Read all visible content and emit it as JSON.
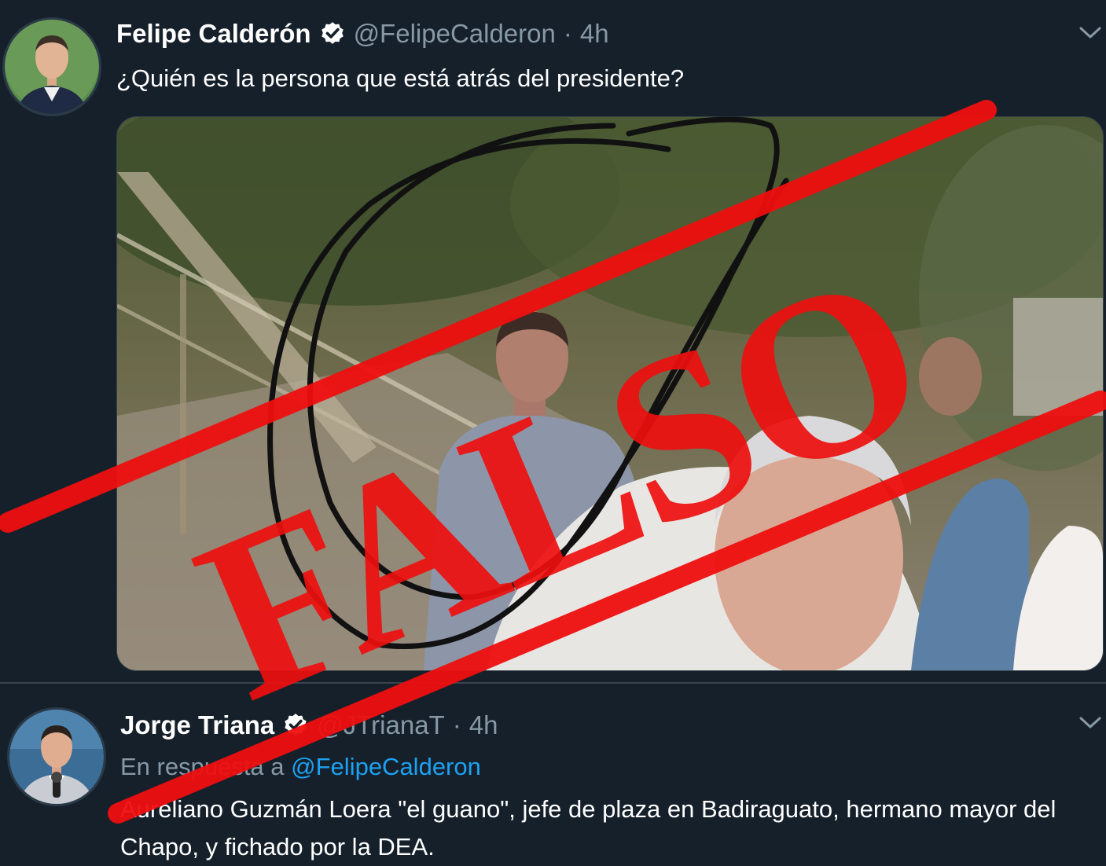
{
  "tweets": [
    {
      "author_name": "Felipe Calderón",
      "handle": "@FelipeCalderon",
      "separator": "·",
      "time": "4h",
      "text": "¿Quién es la persona que está atrás del presidente?"
    },
    {
      "author_name": "Jorge Triana",
      "handle": "@JTrianaT",
      "separator": "·",
      "time": "4h",
      "reply_prefix": "En respuesta a",
      "reply_mention": "@FelipeCalderon",
      "text": "Aureliano Guzmán Loera \"el guano\", jefe de plaza en Badiraguato, hermano mayor del Chapo, y fichado por la DEA."
    }
  ],
  "stamp": {
    "text": "FALSO",
    "color": "#ee0f0f"
  },
  "icons": [
    "verified-badge-icon",
    "chevron-down-icon"
  ],
  "colors": {
    "background": "#15202b",
    "secondary_text": "#8899a6",
    "link": "#1da1f2",
    "divider": "#38444d"
  }
}
